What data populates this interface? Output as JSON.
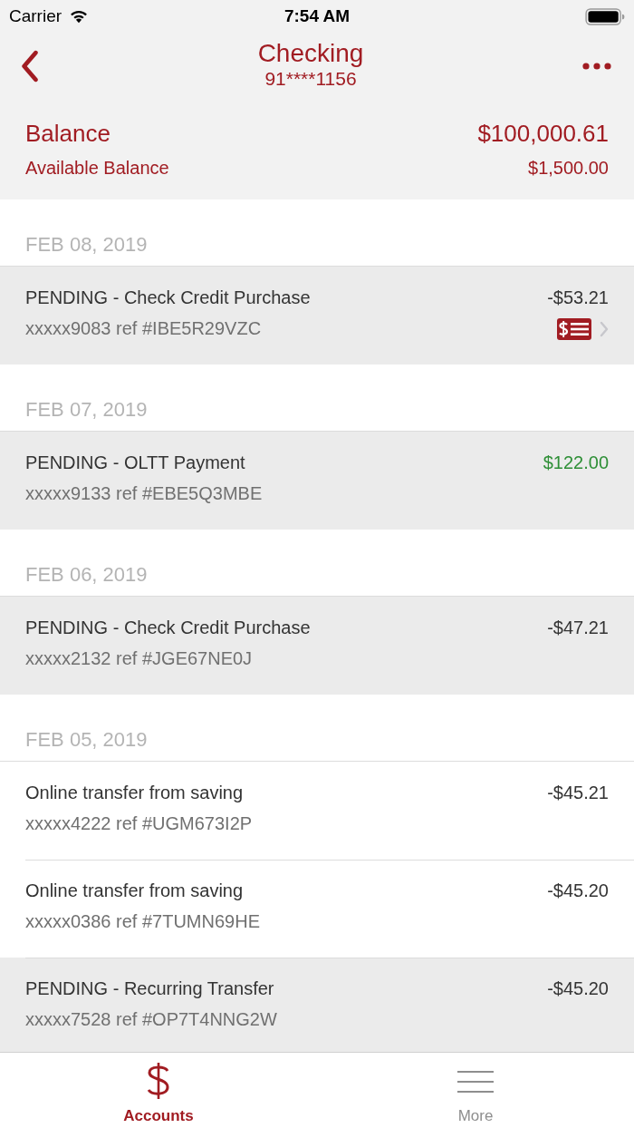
{
  "status_bar": {
    "carrier": "Carrier",
    "time": "7:54 AM"
  },
  "nav": {
    "title": "Checking",
    "subtitle": "91****1156"
  },
  "balances": [
    {
      "label": "Balance",
      "amount": "$100,000.61",
      "kind": "primary"
    },
    {
      "label": "Available Balance",
      "amount": "$1,500.00",
      "kind": "secondary"
    }
  ],
  "sections": [
    {
      "date": "FEB 08, 2019",
      "transactions": [
        {
          "description": "PENDING - Check Credit Purchase",
          "reference": "xxxxx9083 ref #IBE5R29VZC",
          "amount": "-$53.21",
          "pending": true,
          "credit": false,
          "check_image": true
        }
      ]
    },
    {
      "date": "FEB 07, 2019",
      "transactions": [
        {
          "description": "PENDING - OLTT Payment",
          "reference": "xxxxx9133 ref #EBE5Q3MBE",
          "amount": "$122.00",
          "pending": true,
          "credit": true,
          "check_image": false
        }
      ]
    },
    {
      "date": "FEB 06, 2019",
      "transactions": [
        {
          "description": "PENDING - Check Credit Purchase",
          "reference": "xxxxx2132 ref #JGE67NE0J",
          "amount": "-$47.21",
          "pending": true,
          "credit": false,
          "check_image": false
        }
      ]
    },
    {
      "date": "FEB 05, 2019",
      "transactions": [
        {
          "description": "Online transfer from saving",
          "reference": "xxxxx4222 ref #UGM673I2P",
          "amount": "-$45.21",
          "pending": false,
          "credit": false,
          "check_image": false
        },
        {
          "description": "Online transfer from saving",
          "reference": "xxxxx0386 ref #7TUMN69HE",
          "amount": "-$45.20",
          "pending": false,
          "credit": false,
          "check_image": false
        },
        {
          "description": "PENDING - Recurring Transfer",
          "reference": "xxxxx7528 ref #OP7T4NNG2W",
          "amount": "-$45.20",
          "pending": true,
          "credit": false,
          "check_image": false
        }
      ]
    }
  ],
  "tab_bar": [
    {
      "label": "Accounts",
      "kind": "dollar",
      "selected": true
    },
    {
      "label": "More",
      "kind": "menu",
      "selected": false
    }
  ]
}
